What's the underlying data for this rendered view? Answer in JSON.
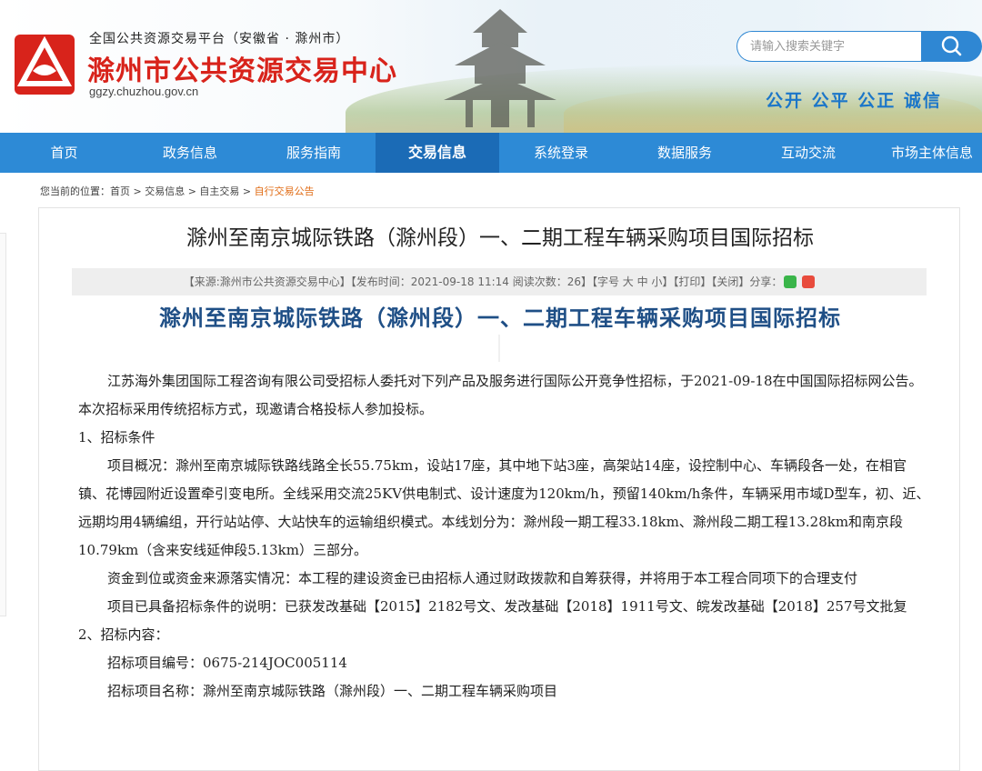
{
  "header": {
    "portal_line": "全国公共资源交易平台（安徽省 · 滁州市）",
    "site_title": "滁州市公共资源交易中心",
    "domain": "ggzy.chuzhou.gov.cn",
    "search_placeholder": "请输入搜索关键字",
    "search_icon": "search-icon",
    "slogan": "公开 公平 公正 诚信",
    "colors": {
      "title_red": "#d8231b",
      "accent_blue": "#2f87d3",
      "slogan_blue": "#1b76c9"
    }
  },
  "nav": {
    "items": [
      {
        "label": "首页"
      },
      {
        "label": "政务信息"
      },
      {
        "label": "服务指南"
      },
      {
        "label": "交易信息"
      },
      {
        "label": "系统登录"
      },
      {
        "label": "数据服务"
      },
      {
        "label": "互动交流"
      },
      {
        "label": "市场主体信息"
      }
    ],
    "active": "交易信息"
  },
  "breadcrumb": {
    "prefix": "您当前的位置：首页 > 交易信息 > 自主交易 > ",
    "current": "自行交易公告"
  },
  "article": {
    "title": "滁州至南京城际铁路（滁州段）一、二期工程车辆采购项目国际招标",
    "meta": "【来源:滁州市公共资源交易中心】【发布时间：2021-09-18 11:14 阅读次数：26】【字号 大 中 小】【打印】【关闭】分享：",
    "share_icons": [
      "wechat-icon",
      "weibo-icon"
    ],
    "doc_heading": "滁州至南京城际铁路（滁州段）一、二期工程车辆采购项目国际招标",
    "paragraphs": [
      {
        "text": "江苏海外集团国际工程咨询有限公司受招标人委托对下列产品及服务进行国际公开竞争性招标，于2021-09-18在中国国际招标网公告。 本次招标采用传统招标方式，现邀请合格投标人参加投标。",
        "indent": true
      },
      {
        "text": "1、招标条件",
        "indent": false
      },
      {
        "text": "项目概况：滁州至南京城际铁路线路全长55.75km，设站17座，其中地下站3座，高架站14座，设控制中心、车辆段各一处，在相官镇、花博园附近设置牵引变电所。全线采用交流25KV供电制式、设计速度为120km/h，预留140km/h条件，车辆采用市域D型车，初、近、远期均用4辆编组，开行站站停、大站快车的运输组织模式。本线划分为：滁州段一期工程33.18km、滁州段二期工程13.28km和南京段10.79km（含来安线延伸段5.13km）三部分。",
        "indent": true
      },
      {
        "text": "资金到位或资金来源落实情况：本工程的建设资金已由招标人通过财政拨款和自筹获得，并将用于本工程合同项下的合理支付",
        "indent": true
      },
      {
        "text": "项目已具备招标条件的说明：已获发改基础【2015】2182号文、发改基础【2018】1911号文、皖发改基础【2018】257号文批复",
        "indent": true
      },
      {
        "text": "2、招标内容：",
        "indent": false
      },
      {
        "text": "招标项目编号：0675-214JOC005114",
        "indent": true
      },
      {
        "text": "招标项目名称：滁州至南京城际铁路（滁州段）一、二期工程车辆采购项目",
        "indent": true
      }
    ]
  }
}
